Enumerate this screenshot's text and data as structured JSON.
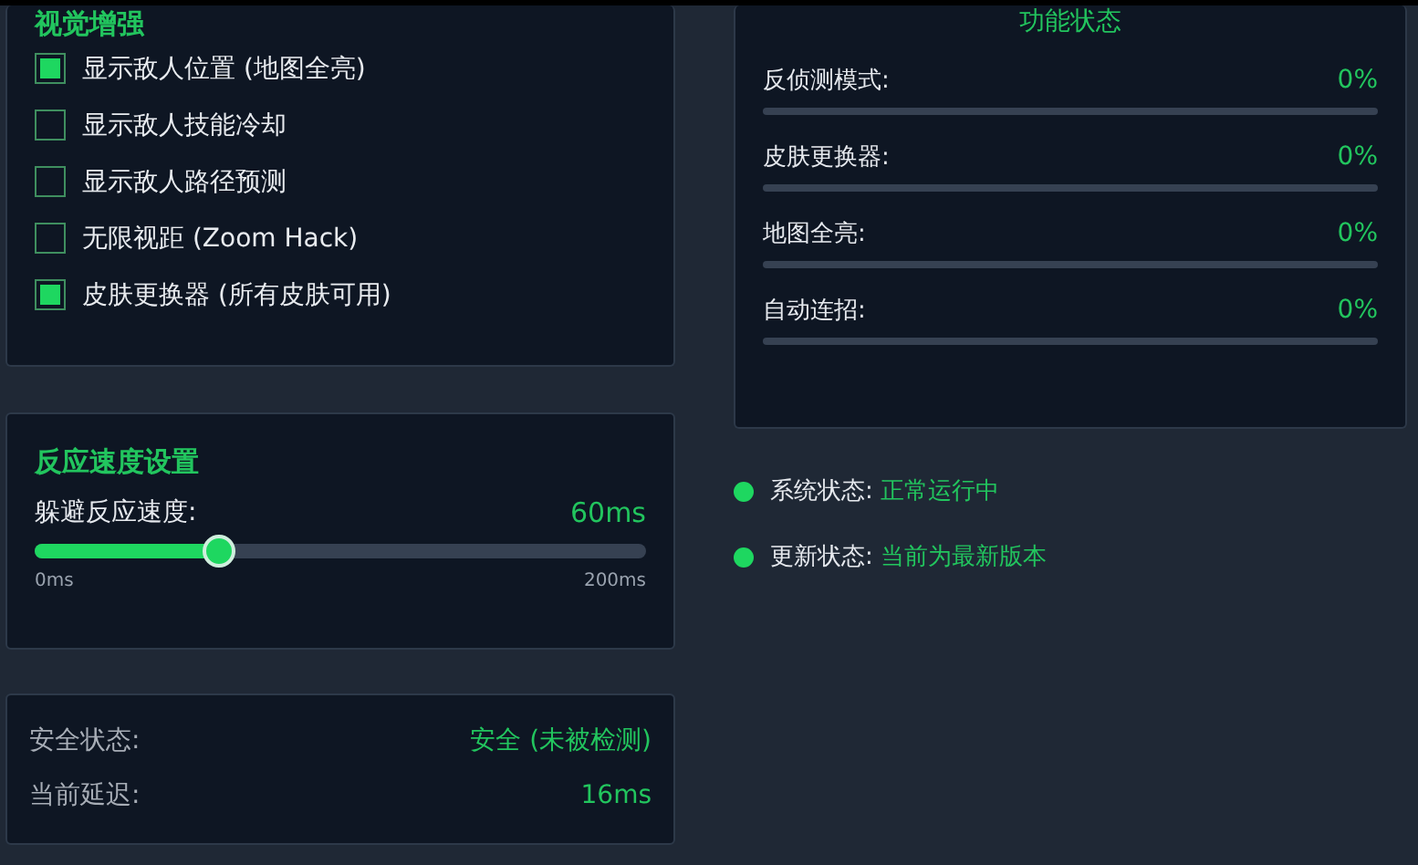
{
  "visual": {
    "title": "视觉增强",
    "options": [
      {
        "label": "显示敌人位置 (地图全亮)",
        "checked": true
      },
      {
        "label": "显示敌人技能冷却",
        "checked": false
      },
      {
        "label": "显示敌人路径预测",
        "checked": false
      },
      {
        "label": "无限视距 (Zoom Hack)",
        "checked": false
      },
      {
        "label": "皮肤更换器 (所有皮肤可用)",
        "checked": true
      }
    ]
  },
  "reaction": {
    "title": "反应速度设置",
    "label": "躲避反应速度:",
    "reading": "60ms",
    "level": 0.3,
    "min": "0ms",
    "max": "200ms"
  },
  "safety": {
    "rows": [
      {
        "label": "安全状态:",
        "value": "安全 (未被检测)"
      },
      {
        "label": "当前延迟:",
        "value": "16ms"
      }
    ]
  },
  "features": {
    "title": "功能状态",
    "items": [
      {
        "label": "反侦测模式:",
        "reading": "0%",
        "level": 0
      },
      {
        "label": "皮肤更换器:",
        "reading": "0%",
        "level": 0
      },
      {
        "label": "地图全亮:",
        "reading": "0%",
        "level": 0
      },
      {
        "label": "自动连招:",
        "reading": "0%",
        "level": 0
      }
    ]
  },
  "status": [
    {
      "label": "系统状态:",
      "value": "正常运行中",
      "color": "#1ed760"
    },
    {
      "label": "更新状态:",
      "value": "当前为最新版本",
      "color": "#1ed760"
    }
  ]
}
